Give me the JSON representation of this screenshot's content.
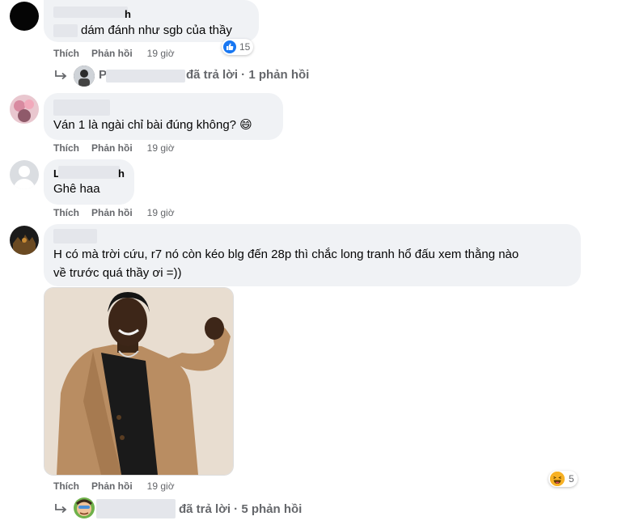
{
  "comments": [
    {
      "text": "dám đánh như sgb của thầy",
      "author_fragment": "h",
      "actions": {
        "like": "Thích",
        "reply": "Phản hồi",
        "time": "19 giờ"
      },
      "reaction_count": "15",
      "replies": {
        "author_fragment": "P",
        "summary": "đã trả lời · 1 phản hồi"
      }
    },
    {
      "text": "Ván 1 là ngài chỉ bài đúng không? 😄",
      "actions": {
        "like": "Thích",
        "reply": "Phản hồi",
        "time": "19 giờ"
      }
    },
    {
      "text": "Ghê haa",
      "author_fragment_left": "L",
      "author_fragment_right": "h",
      "actions": {
        "like": "Thích",
        "reply": "Phản hồi",
        "time": "19 giờ"
      }
    },
    {
      "text_line1": "H có mà trời cứu, r7 nó còn kéo blg đến 28p thì chắc long tranh hổ đấu xem thằng nào",
      "text_line2": "về trước quá thầy ơi =))",
      "actions": {
        "like": "Thích",
        "reply": "Phản hồi",
        "time": "19 giờ"
      },
      "reaction_count": "5",
      "replies": {
        "summary": "đã trả lời · 5 phản hồi"
      }
    }
  ],
  "colors": {
    "bubble": "#f0f2f5",
    "muted": "#65676b",
    "like_blue": "#1877f2",
    "haha_yellow": "#f7b125"
  },
  "icons": [
    "reply-arrow-icon",
    "like-icon",
    "haha-icon",
    "avatar"
  ]
}
